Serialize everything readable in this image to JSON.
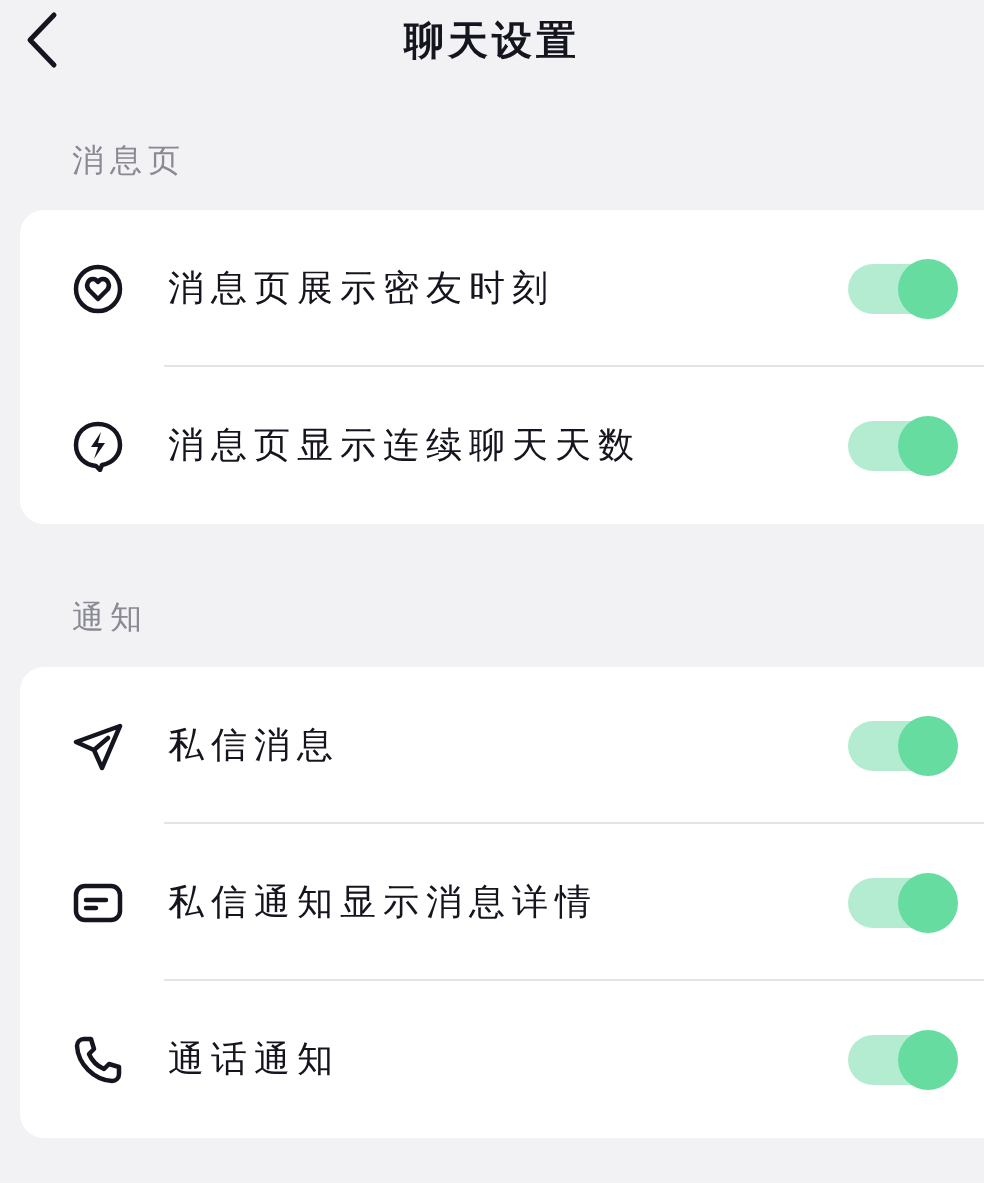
{
  "header": {
    "title": "聊天设置"
  },
  "sections": [
    {
      "label": "消息页",
      "rows": [
        {
          "label": "消息页展示密友时刻",
          "on": true
        },
        {
          "label": "消息页显示连续聊天天数",
          "on": true
        }
      ]
    },
    {
      "label": "通知",
      "rows": [
        {
          "label": "私信消息",
          "on": true
        },
        {
          "label": "私信通知显示消息详情",
          "on": true
        },
        {
          "label": "通话通知",
          "on": true
        }
      ]
    }
  ]
}
